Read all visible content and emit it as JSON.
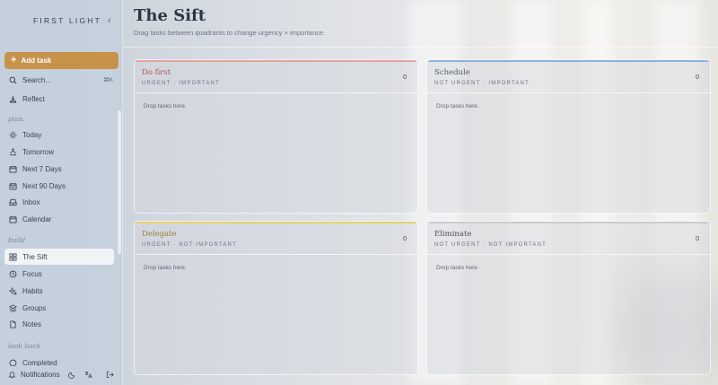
{
  "brand": "FIRST LIGHT",
  "sidebar": {
    "add_task": "Add task",
    "search": "Search...",
    "search_shortcut": "⌘K",
    "reflect": "Reflect",
    "sections": {
      "plan": "plan.",
      "build": "build",
      "look_back": "look back"
    },
    "plan_items": [
      "Today",
      "Tomorrow",
      "Next 7 Days",
      "Next 90 Days",
      "Inbox",
      "Calendar"
    ],
    "build_items": [
      "The Sift",
      "Focus",
      "Habits",
      "Groups",
      "Notes"
    ],
    "look_back_items": [
      "Completed"
    ],
    "active_item": "The Sift",
    "footer": {
      "notifications": "Notifications"
    }
  },
  "main": {
    "title": "The Sift",
    "subtitle": "Drag tasks between quadrants to change urgency × importance.",
    "quadrants": [
      {
        "title": "Do first",
        "subtitle": "URGENT · IMPORTANT",
        "count": "0",
        "empty": "Drop tasks here.",
        "accent": "#e8a0a0",
        "title_color": "#b3544f"
      },
      {
        "title": "Schedule",
        "subtitle": "NOT URGENT · IMPORTANT",
        "count": "0",
        "empty": "Drop tasks here.",
        "accent": "#8fb0e0",
        "title_color": "#4d5a78"
      },
      {
        "title": "Delegate",
        "subtitle": "URGENT · NOT IMPORTANT",
        "count": "0",
        "empty": "Drop tasks here.",
        "accent": "#e6d36a",
        "title_color": "#a07d2e"
      },
      {
        "title": "Eliminate",
        "subtitle": "NOT URGENT · NOT IMPORTANT",
        "count": "0",
        "empty": "Drop tasks here.",
        "accent": "#c9ccd2",
        "title_color": "#4a5060"
      }
    ]
  },
  "colors": {
    "accent_button": "#c7934a",
    "sidebar_bg": "#c4d0de"
  }
}
